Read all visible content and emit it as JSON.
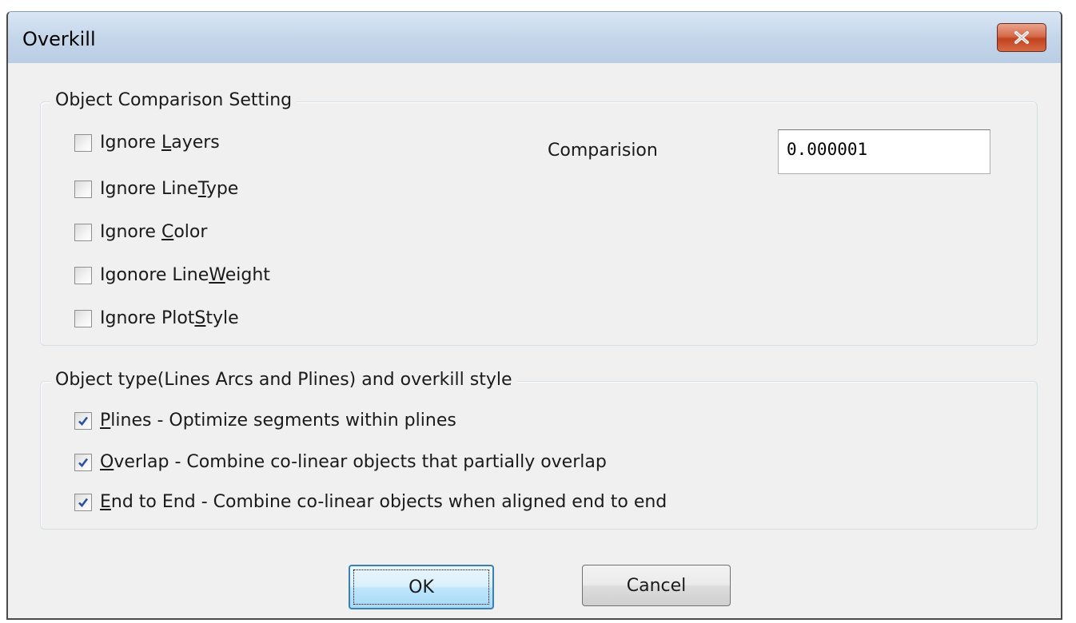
{
  "window": {
    "title": "Overkill"
  },
  "comparison_group": {
    "title": "Object Comparison Setting",
    "options": [
      {
        "pre": "Ignore ",
        "key": "L",
        "post": "ayers",
        "checked": false
      },
      {
        "pre": "Ignore Line",
        "key": "T",
        "post": "ype",
        "checked": false
      },
      {
        "pre": "Ignore ",
        "key": "C",
        "post": "olor",
        "checked": false
      },
      {
        "pre": "Igonore Line",
        "key": "W",
        "post": "eight",
        "checked": false
      },
      {
        "pre": "Ignore Plot",
        "key": "S",
        "post": "tyle",
        "checked": false
      }
    ],
    "comparison_label": "Comparision",
    "comparison_value": "0.000001"
  },
  "object_type_group": {
    "title": "Object type(Lines Arcs and Plines) and overkill style",
    "options": [
      {
        "pre": "",
        "key": "P",
        "post": "lines - Optimize segments within plines",
        "checked": true
      },
      {
        "pre": "",
        "key": "O",
        "post": "verlap - Combine co-linear objects that partially overlap",
        "checked": true
      },
      {
        "pre": "",
        "key": "E",
        "post": "nd to End - Combine co-linear objects when aligned end to end",
        "checked": true
      }
    ]
  },
  "buttons": {
    "ok": "OK",
    "cancel": "Cancel"
  },
  "icons": {
    "close": "close-icon",
    "check": "checkmark-icon"
  },
  "colors": {
    "close_button": "#c7502f",
    "check_mark": "#2a4fa3",
    "title_bar": "#c5d6ea"
  }
}
